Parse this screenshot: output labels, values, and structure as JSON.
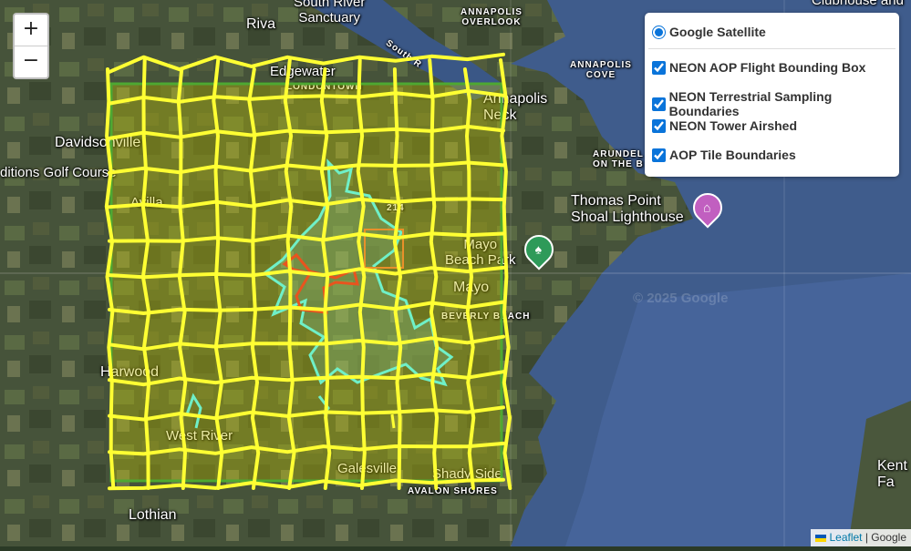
{
  "map": {
    "watermark": "© 2025 Google",
    "places": [
      {
        "id": "riva",
        "label": "Riva"
      },
      {
        "id": "south-river-sanctuary",
        "label": "South River\nSanctuary"
      },
      {
        "id": "annapolis-overlook",
        "label": "ANNAPOLIS\nOVERLOOK"
      },
      {
        "id": "clubhouse",
        "label": "Clubhouse and"
      },
      {
        "id": "edgewater",
        "label": "Edgewater"
      },
      {
        "id": "londontown",
        "label": "LONDONTOWN"
      },
      {
        "id": "annapolis-cove",
        "label": "ANNAPOLIS\nCOVE"
      },
      {
        "id": "annapolis-neck",
        "label": "Annapolis\nNeck"
      },
      {
        "id": "davidsonville",
        "label": "Davidsonville"
      },
      {
        "id": "golf-course",
        "label": "ditions Golf Course"
      },
      {
        "id": "arundel",
        "label": "ARUNDEL\nON THE B"
      },
      {
        "id": "avilla",
        "label": "Avilla"
      },
      {
        "id": "thomas-point",
        "label": "Thomas Point\nShoal Lighthouse"
      },
      {
        "id": "mayo-beach-park",
        "label": "Mayo\nBeach Park"
      },
      {
        "id": "mayo",
        "label": "Mayo"
      },
      {
        "id": "beverly-beach",
        "label": "BEVERLY BEACH"
      },
      {
        "id": "harwood",
        "label": "Harwood"
      },
      {
        "id": "west-river",
        "label": "West River"
      },
      {
        "id": "galesville",
        "label": "Galesville"
      },
      {
        "id": "shady-side",
        "label": "Shady Side"
      },
      {
        "id": "avalon-shores",
        "label": "AVALON SHORES"
      },
      {
        "id": "lothian",
        "label": "Lothian"
      },
      {
        "id": "kent",
        "label": "Kent\nFa"
      },
      {
        "id": "route-214",
        "label": "214"
      },
      {
        "id": "south-river",
        "label": "South R"
      }
    ]
  },
  "zoom": {
    "in": "+",
    "out": "−"
  },
  "layers": {
    "base": "Google Satellite",
    "overlays": [
      {
        "label": "NEON AOP Flight Bounding Box",
        "checked": true
      },
      {
        "label": "NEON Terrestrial Sampling Boundaries",
        "checked": true
      },
      {
        "label": "NEON Tower Airshed",
        "checked": true
      },
      {
        "label": "AOP Tile Boundaries",
        "checked": true
      }
    ]
  },
  "attribution": {
    "leaflet": "Leaflet",
    "separator": " | ",
    "google": "Google"
  },
  "colors": {
    "water": "#3d5a8a",
    "land": "#44533a",
    "tile_grid": "#ffff33",
    "aop_box": "#4ea832",
    "terrestrial": "#6ff0c8",
    "airshed": "#e8541e"
  }
}
